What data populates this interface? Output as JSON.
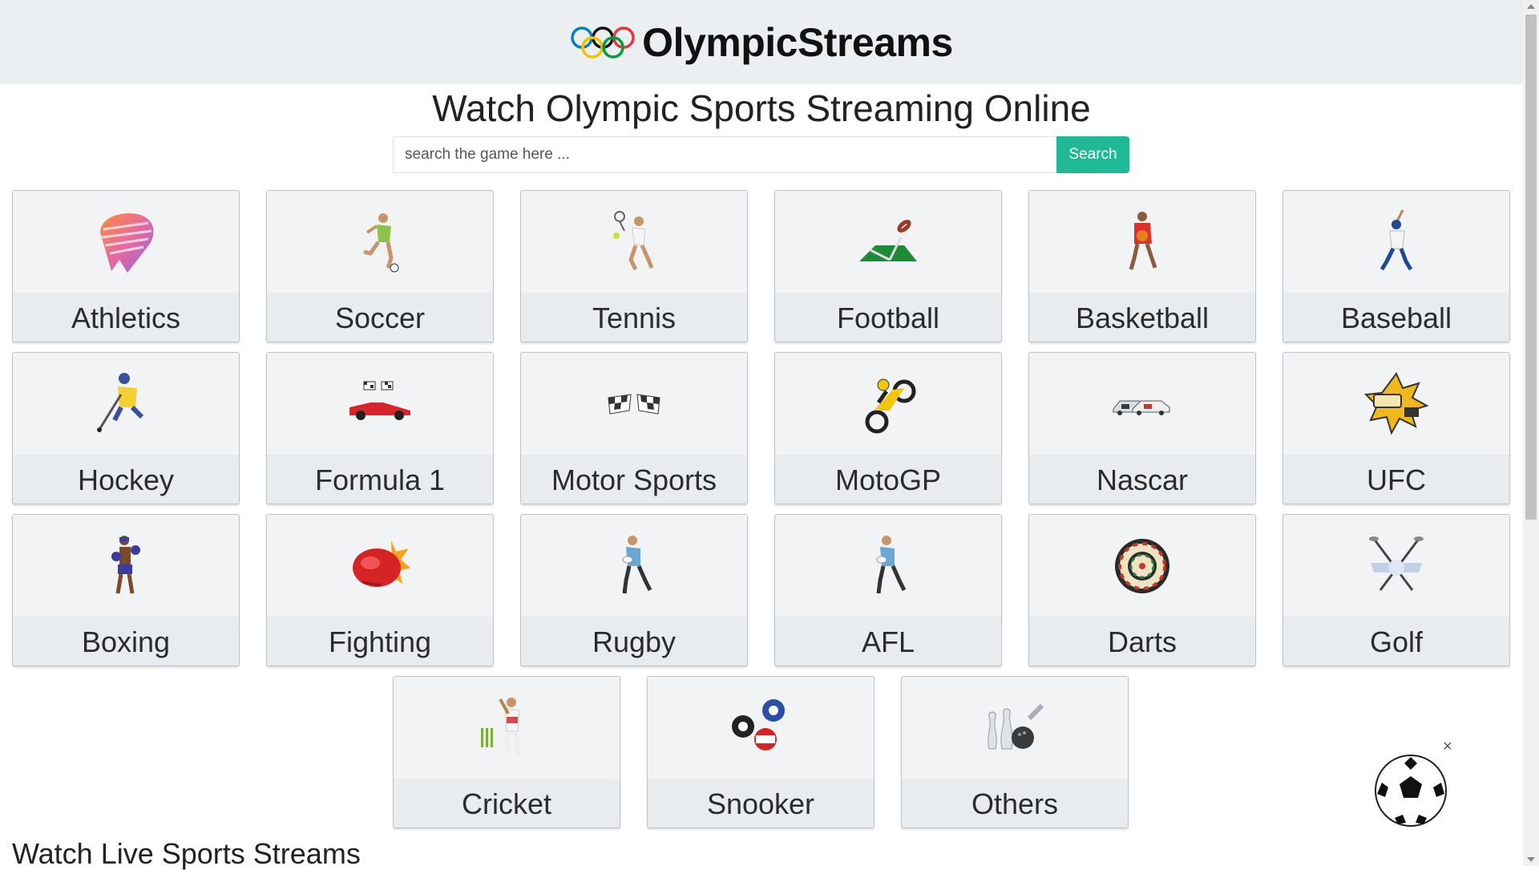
{
  "header": {
    "brand": "OlympicStreams"
  },
  "page_title": "Watch Olympic Sports Streaming Online",
  "search": {
    "placeholder": "search the game here ...",
    "button_label": "Search"
  },
  "sports": [
    {
      "label": "Athletics",
      "icon": "athletics-icon"
    },
    {
      "label": "Soccer",
      "icon": "soccer-player-icon"
    },
    {
      "label": "Tennis",
      "icon": "tennis-player-icon"
    },
    {
      "label": "Football",
      "icon": "football-icon"
    },
    {
      "label": "Basketball",
      "icon": "basketball-player-icon"
    },
    {
      "label": "Baseball",
      "icon": "baseball-player-icon"
    },
    {
      "label": "Hockey",
      "icon": "hockey-player-icon"
    },
    {
      "label": "Formula 1",
      "icon": "race-car-icon"
    },
    {
      "label": "Motor Sports",
      "icon": "checkered-flags-icon"
    },
    {
      "label": "MotoGP",
      "icon": "motorcycle-icon"
    },
    {
      "label": "Nascar",
      "icon": "stock-cars-icon"
    },
    {
      "label": "UFC",
      "icon": "ufc-fist-icon"
    },
    {
      "label": "Boxing",
      "icon": "boxer-icon"
    },
    {
      "label": "Fighting",
      "icon": "boxing-glove-icon"
    },
    {
      "label": "Rugby",
      "icon": "rugby-player-icon"
    },
    {
      "label": "AFL",
      "icon": "afl-player-icon"
    },
    {
      "label": "Darts",
      "icon": "dartboard-icon"
    },
    {
      "label": "Golf",
      "icon": "golf-clubs-icon"
    },
    {
      "label": "Cricket",
      "icon": "cricket-player-icon"
    },
    {
      "label": "Snooker",
      "icon": "billiard-balls-icon"
    },
    {
      "label": "Others",
      "icon": "bowling-icon"
    }
  ],
  "section_title": "Watch Live Sports Streams",
  "colors": {
    "accent": "#20b996",
    "header_bg": "#eceff1",
    "tile_bg": "#e9ecef"
  },
  "floating_widget": {
    "icon": "soccer-ball-icon",
    "close_label": "×"
  }
}
